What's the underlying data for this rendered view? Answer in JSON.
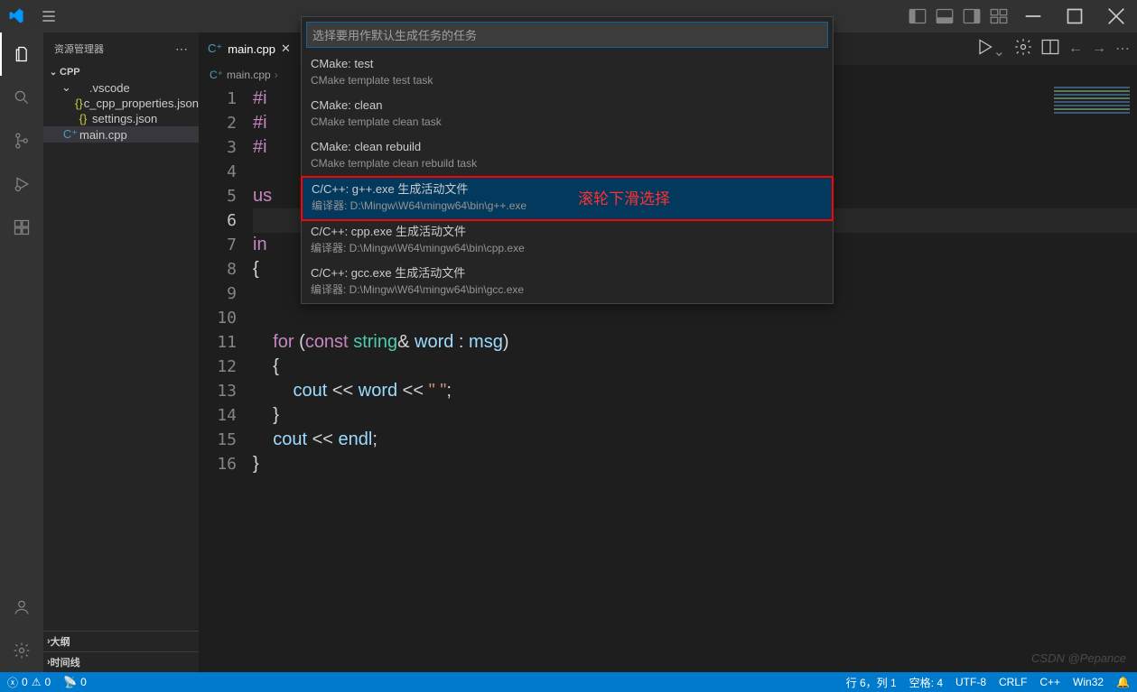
{
  "titlebar": {
    "layout_icons": [
      "panel-left-icon",
      "panel-bottom-icon",
      "panel-right-icon",
      "layout-icon"
    ]
  },
  "sidebar": {
    "title": "资源管理器",
    "section": "CPP",
    "folder1": ".vscode",
    "file1": "c_cpp_properties.json",
    "file2": "settings.json",
    "file3": "main.cpp",
    "outline": "大纲",
    "timeline": "时间线"
  },
  "tabs": {
    "main": "main.cpp"
  },
  "breadcrumb": {
    "file": "main.cpp"
  },
  "quickpick": {
    "placeholder": "选择要用作默认生成任务的任务",
    "items": [
      {
        "title": "CMake: test",
        "sub": "CMake template test task"
      },
      {
        "title": "CMake: clean",
        "sub": "CMake template clean task"
      },
      {
        "title": "CMake: clean rebuild",
        "sub": "CMake template clean rebuild task"
      },
      {
        "title": "C/C++: g++.exe 生成活动文件",
        "sub": "编译器: D:\\Mingw\\W64\\mingw64\\bin\\g++.exe"
      },
      {
        "title": "C/C++: cpp.exe 生成活动文件",
        "sub": "编译器: D:\\Mingw\\W64\\mingw64\\bin\\cpp.exe"
      },
      {
        "title": "C/C++: gcc.exe 生成活动文件",
        "sub": "编译器: D:\\Mingw\\W64\\mingw64\\bin\\gcc.exe"
      }
    ],
    "annotation": "滚轮下滑选择"
  },
  "code": {
    "line1_pre": "#i",
    "line2_pre": "#i",
    "line3_pre": "#i",
    "line5_kw": "us",
    "line7_kw": "in",
    "line9_for": "for",
    "line9_const": "const",
    "line9_string": "string",
    "line9_amp": "&",
    "line9_word": "word",
    "line9_colon": ":",
    "line9_msg": "msg",
    "line11_openb": "{",
    "line12_cout": "cout",
    "line12_lt1": "<<",
    "line12_word": "word",
    "line12_lt2": "<<",
    "line12_str": "\" \"",
    "line12_semi": ";",
    "line13_closeb": "}",
    "line14_cout": "cout",
    "line14_lt": "<<",
    "line14_endl": "endl",
    "line14_semi": ";",
    "line15_cb": "}",
    "line8_ob": "{"
  },
  "status": {
    "errors": "0",
    "warnings": "0",
    "ports": "0",
    "line_col": "行 6，列 1",
    "spaces": "空格: 4",
    "encoding": "UTF-8",
    "eol": "CRLF",
    "lang": "C++",
    "compiler": "Win32",
    "bell": ""
  },
  "watermark": "CSDN @Pepance"
}
